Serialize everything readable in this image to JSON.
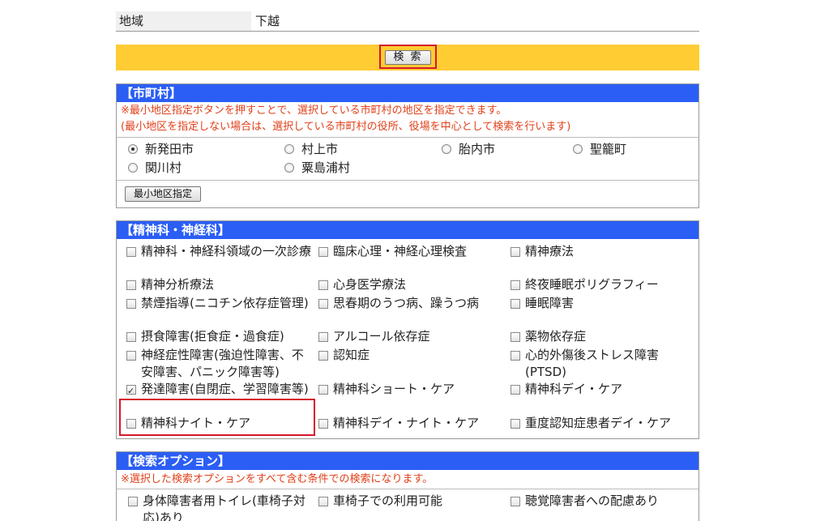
{
  "region": {
    "label": "地域",
    "value": "下越"
  },
  "search": {
    "button_label": "検 索"
  },
  "municipality": {
    "title": "【市町村】",
    "notice_lines": [
      "※最小地区指定ボタンを押すことで、選択している市町村の地区を指定できます。",
      "(最小地区を指定しない場合は、選択している市町村の役所、役場を中心として検索を行います)"
    ],
    "options": [
      {
        "label": "新発田市",
        "selected": true
      },
      {
        "label": "村上市",
        "selected": false
      },
      {
        "label": "胎内市",
        "selected": false
      },
      {
        "label": "聖籠町",
        "selected": false
      },
      {
        "label": "関川村",
        "selected": false
      },
      {
        "label": "粟島浦村",
        "selected": false
      }
    ],
    "min_area_button": "最小地区指定"
  },
  "psychiatry": {
    "title": "【精神科・神経科】",
    "items": [
      {
        "label": "精神科・神経科領域の一次診療",
        "checked": false
      },
      {
        "label": "臨床心理・神経心理検査",
        "checked": false
      },
      {
        "label": "精神療法",
        "checked": false
      },
      {
        "label": "精神分析療法",
        "checked": false
      },
      {
        "label": "心身医学療法",
        "checked": false
      },
      {
        "label": "終夜睡眠ポリグラフィー",
        "checked": false
      },
      {
        "label": "禁煙指導(ニコチン依存症管理)",
        "checked": false
      },
      {
        "label": "思春期のうつ病、躁うつ病",
        "checked": false
      },
      {
        "label": "睡眠障害",
        "checked": false
      },
      {
        "label": "摂食障害(拒食症・過食症)",
        "checked": false
      },
      {
        "label": "アルコール依存症",
        "checked": false
      },
      {
        "label": "薬物依存症",
        "checked": false
      },
      {
        "label": "神経症性障害(強迫性障害、不安障害、パニック障害等)",
        "checked": false
      },
      {
        "label": "認知症",
        "checked": false
      },
      {
        "label": "心的外傷後ストレス障害(PTSD)",
        "checked": false
      },
      {
        "label": "発達障害(自閉症、学習障害等)",
        "checked": true
      },
      {
        "label": "精神科ショート・ケア",
        "checked": false
      },
      {
        "label": "精神科デイ・ケア",
        "checked": false
      },
      {
        "label": "精神科ナイト・ケア",
        "checked": false
      },
      {
        "label": "精神科デイ・ナイト・ケア",
        "checked": false
      },
      {
        "label": "重度認知症患者デイ・ケア",
        "checked": false
      }
    ]
  },
  "search_options": {
    "title": "【検索オプション】",
    "notice": "※選択した検索オプションをすべて含む条件での検索になります。",
    "items": [
      {
        "label": "身体障害者用トイレ(車椅子対応)あり",
        "checked": false
      },
      {
        "label": "車椅子での利用可能",
        "checked": false
      },
      {
        "label": "聴覚障害者への配慮あり",
        "checked": false
      }
    ]
  }
}
